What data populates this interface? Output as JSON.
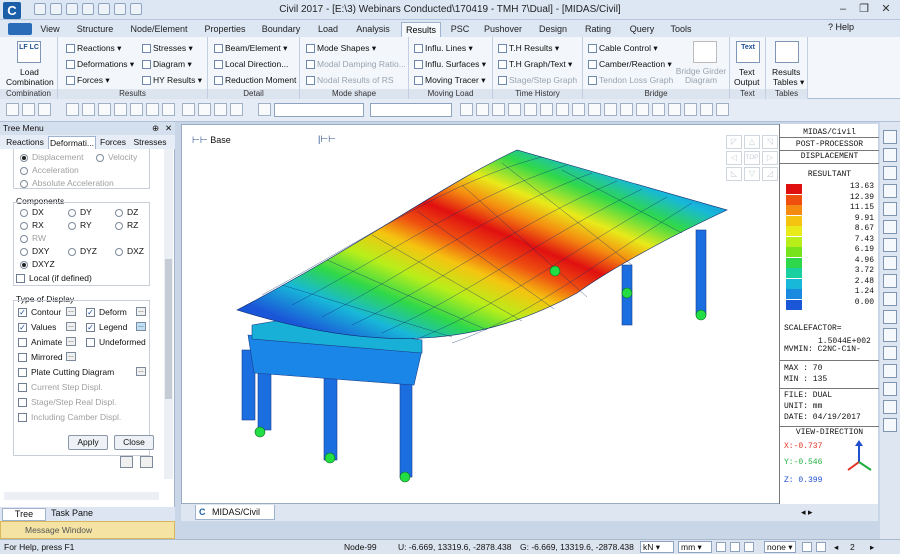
{
  "app_logo": "C",
  "window_title": "Civil 2017 - [E:\\3) Webinars Conducted\\170419 - TMH 7\\Dual] - [MIDAS/Civil]",
  "help_label": "Help",
  "tabs": [
    "View",
    "Structure",
    "Node/Element",
    "Properties",
    "Boundary",
    "Load",
    "Analysis",
    "Results",
    "PSC",
    "Pushover",
    "Design",
    "Rating",
    "Query",
    "Tools"
  ],
  "ribbon": {
    "load_combination": {
      "icon": "LF LC",
      "label1": "Load",
      "label2": "Combination",
      "group": "Combination"
    },
    "results_group": {
      "group": "Results",
      "items": [
        "Reactions",
        "Deformations",
        "Forces",
        "Stresses",
        "Diagram",
        "HY Results"
      ]
    },
    "detail_group": {
      "group": "Detail",
      "items": [
        "Beam/Element",
        "Local Direction...",
        "Reduction Moment"
      ]
    },
    "mode_group": {
      "group": "Mode shape",
      "items": [
        "Mode Shapes",
        "Modal Damping Ratio...",
        "Nodal Results of RS"
      ]
    },
    "moving_group": {
      "group": "Moving Load",
      "items": [
        "Influ. Lines",
        "Influ. Surfaces",
        "Moving Tracer"
      ]
    },
    "time_group": {
      "group": "Time History",
      "items": [
        "T.H Results",
        "T.H Graph/Text",
        "Stage/Step Graph"
      ]
    },
    "bridge_group": {
      "group": "Bridge",
      "items": [
        "Cable Control",
        "Camber/Reaction",
        "Tendon Loss Graph"
      ],
      "big": "Bridge Girder Diagram"
    },
    "text_group": {
      "group": "Text",
      "icon": "Text",
      "label1": "Text",
      "label2": "Output"
    },
    "tables_group": {
      "group": "Tables",
      "label1": "Results",
      "label2": "Tables"
    }
  },
  "tree": {
    "header": "Tree Menu",
    "subtabs": [
      "Reactions",
      "Deformati...",
      "Forces",
      "Stresses"
    ],
    "top_options": [
      "Displacement",
      "Velocity",
      "Acceleration",
      "Absolute Acceleration"
    ],
    "components_title": "Components",
    "components": [
      "DX",
      "DY",
      "DZ",
      "RX",
      "RY",
      "RZ",
      "RW",
      "DXY",
      "DYZ",
      "DXZ",
      "DXYZ"
    ],
    "local_label": "Local (if defined)",
    "display_title": "Type of Display",
    "display": [
      "Contour",
      "Deform",
      "Values",
      "Legend",
      "Animate",
      "Undeformed",
      "Mirrored"
    ],
    "plate_cutting": "Plate Cutting Diagram",
    "disabled_opts": [
      "Current Step Displ.",
      "Stage/Step Real Displ.",
      "Including Camber Displ."
    ],
    "apply": "Apply",
    "close": "Close",
    "footer_tabs": [
      "Tree Menu",
      "Task Pane"
    ]
  },
  "message_window": "Message Window",
  "view": {
    "base_label": "Base",
    "tab": "MIDAS/Civil",
    "nav_label": "TOP"
  },
  "legend": {
    "title1": "MIDAS/Civil",
    "title2": "POST-PROCESSOR",
    "title3": "DISPLACEMENT",
    "title4": "RESULTANT",
    "values": [
      "13.63",
      "12.39",
      "11.15",
      "9.91",
      "8.67",
      "7.43",
      "6.19",
      "4.96",
      "3.72",
      "2.48",
      "1.24",
      "0.00"
    ],
    "colors": [
      "#e01010",
      "#ef5010",
      "#f58a10",
      "#f5c410",
      "#e8ea1a",
      "#b8ee1a",
      "#78e21a",
      "#2fd84a",
      "#18d0a0",
      "#18b8d8",
      "#1a8ae0",
      "#1a56d8"
    ],
    "scale_label": "SCALEFACTOR=",
    "scale_value": "1.5044E+002",
    "mvmin": "MVMIN: C2NC-C1N-",
    "max": "MAX : 70",
    "min": "MIN : 135",
    "file": "FILE: DUAL",
    "unit": "UNIT: mm",
    "date": "DATE: 04/19/2017",
    "view_dir": "VIEW-DIRECTION",
    "x": "X:-0.737",
    "y": "Y:-0.546",
    "z": "Z: 0.399"
  },
  "status": {
    "help": "For Help, press F1",
    "node": "Node-99",
    "u": "U: -6.669, 13319.6, -2878.438",
    "g": "G: -6.669, 13319.6, -2878.438",
    "force_unit": "kN",
    "len_unit": "mm",
    "none": "none",
    "page": "2"
  }
}
